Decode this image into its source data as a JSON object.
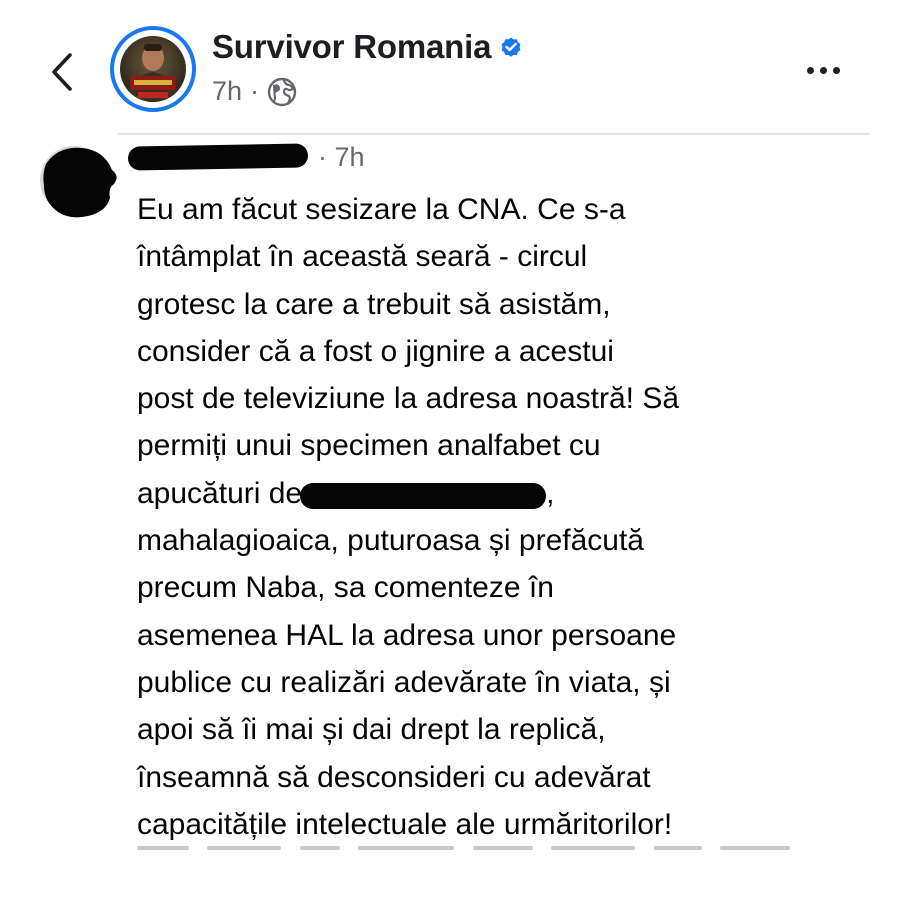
{
  "header": {
    "page_name": "Survivor Romania",
    "post_time": "7h",
    "separator": "·",
    "verified_icon": "verified-badge-icon",
    "audience_icon": "globe-icon",
    "back_icon": "chevron-left-icon",
    "more_icon": "more-horizontal-icon"
  },
  "comment": {
    "time": "· 7h",
    "lines": [
      "Eu am făcut sesizare la CNA. Ce s-a",
      "întâmplat în această seară - circul",
      "grotesc la care a trebuit să asistăm,",
      "consider că a fost o jignire a acestui",
      "post de televiziune la adresa noastră! Să",
      "permiți unui specimen analfabet cu",
      "apucături de",
      ",",
      "mahalagioaica, puturoasa și prefăcută",
      "precum Naba, sa comenteze în",
      "asemenea HAL la adresa unor persoane",
      "publice cu realizări adevărate în viata, și",
      "apoi să îi mai și dai drept la replică,",
      "înseamnă să desconsideri cu adevărat",
      "capacitățile intelectuale ale urmăritorilor!"
    ]
  },
  "colors": {
    "brand_blue": "#1877f2",
    "text_primary": "#050505",
    "text_secondary": "#65676b",
    "divider": "#e4e6eb",
    "redaction": "#050505"
  }
}
